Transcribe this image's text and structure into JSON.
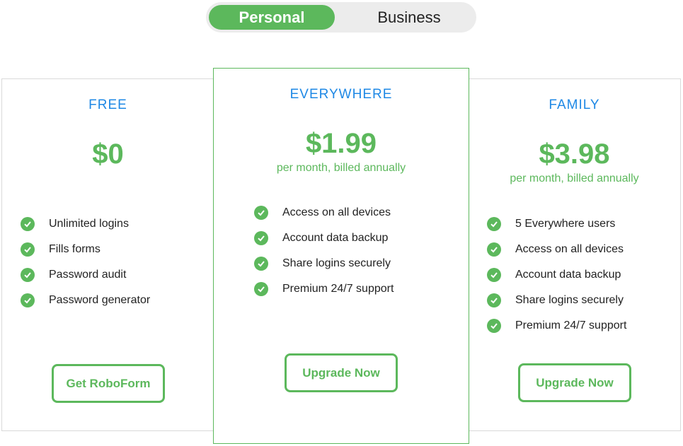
{
  "toggle": {
    "personal_label": "Personal",
    "business_label": "Business"
  },
  "plans": [
    {
      "name": "FREE",
      "price": "$0",
      "billing": "",
      "features": [
        "Unlimited logins",
        "Fills forms",
        "Password audit",
        "Password generator"
      ],
      "cta": "Get RoboForm"
    },
    {
      "name": "EVERYWHERE",
      "price": "$1.99",
      "billing": "per month, billed annually",
      "features": [
        "Access on all devices",
        "Account data backup",
        "Share logins securely",
        "Premium 24/7 support"
      ],
      "cta": "Upgrade Now"
    },
    {
      "name": "FAMILY",
      "price": "$3.98",
      "billing": "per month, billed annually",
      "features": [
        "5 Everywhere users",
        "Access on all devices",
        "Account data backup",
        "Share logins securely",
        "Premium 24/7 support"
      ],
      "cta": "Upgrade Now"
    }
  ],
  "colors": {
    "accent": "#5cb85c",
    "plan_title": "#1e88e5",
    "toggle_bg": "#ececec"
  },
  "icons": {
    "feature": "check-circle-icon"
  }
}
